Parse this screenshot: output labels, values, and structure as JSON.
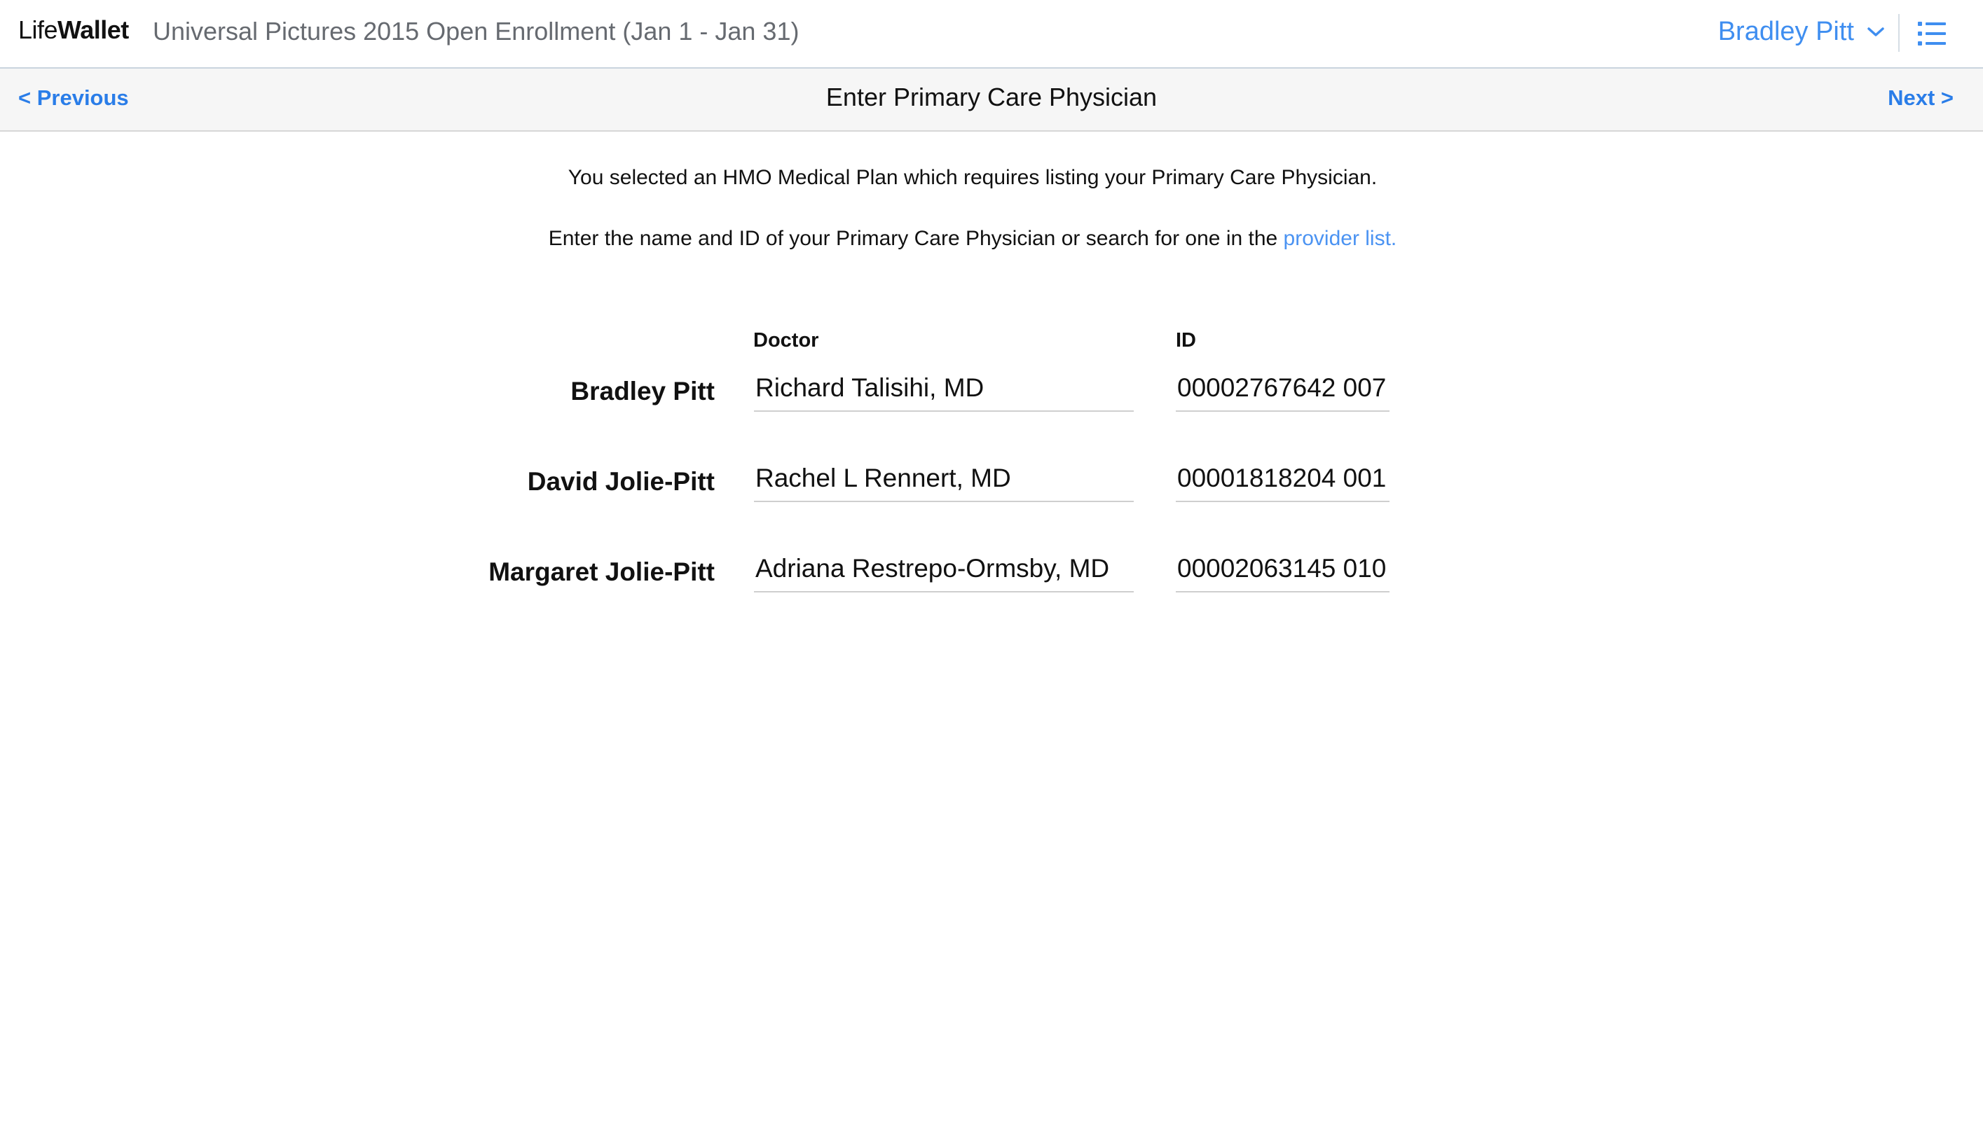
{
  "header": {
    "brand_prefix": "Life",
    "brand_suffix": "Wallet",
    "enrollment_title": "Universal Pictures 2015 Open Enrollment (Jan 1 - Jan 31)",
    "user_name": "Bradley Pitt",
    "user_menu_icon": "chevron-down-icon",
    "menu_icon": "list-icon",
    "accent_color": "#3f8ef0"
  },
  "nav": {
    "previous_label": "< Previous",
    "title": "Enter Primary Care Physician",
    "next_label": "Next >"
  },
  "intro": {
    "line1": "You selected an HMO Medical Plan which requires listing your Primary Care Physician.",
    "line2_text": "Enter the name and ID of your Primary Care Physician or search for one in the ",
    "line2_link": "provider list."
  },
  "form": {
    "doctor_header": "Doctor",
    "id_header": "ID",
    "rows": [
      {
        "member": "Bradley Pitt",
        "doctor": "Richard Talisihi, MD",
        "id": "00002767642 007"
      },
      {
        "member": "David Jolie-Pitt",
        "doctor": "Rachel L Rennert, MD",
        "id": "00001818204 001"
      },
      {
        "member": "Margaret Jolie-Pitt",
        "doctor": "Adriana Restrepo-Ormsby, MD",
        "id": "00002063145 010"
      }
    ]
  }
}
